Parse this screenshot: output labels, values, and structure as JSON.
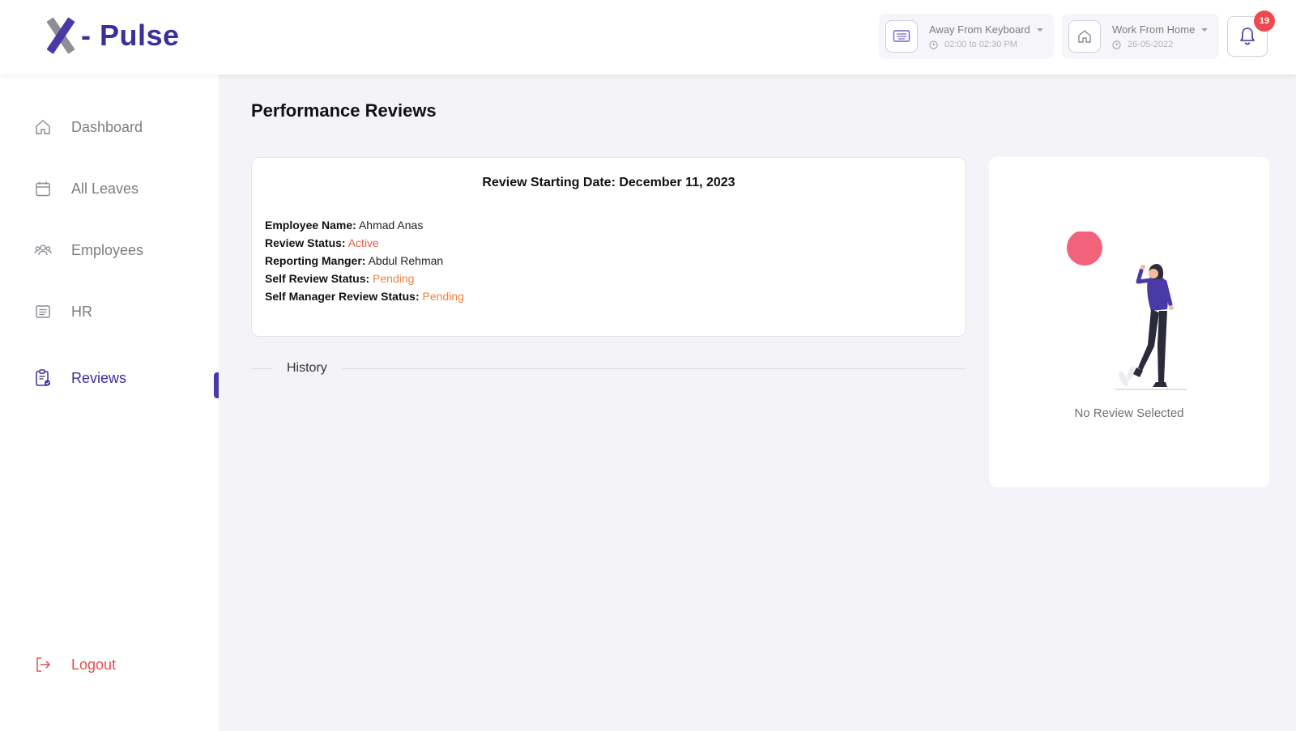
{
  "app": {
    "logo_text": "- Pulse"
  },
  "header": {
    "away_status": {
      "title": "Away From Keyboard",
      "sub": "02:00 to 02:30 PM"
    },
    "work_status": {
      "title": "Work From Home",
      "sub": "26-05-2022"
    },
    "notifications_count": "19"
  },
  "sidebar": {
    "items": [
      {
        "label": "Dashboard",
        "icon": "home-icon"
      },
      {
        "label": "All Leaves",
        "icon": "calendar-icon"
      },
      {
        "label": "Employees",
        "icon": "users-icon"
      },
      {
        "label": "HR",
        "icon": "list-icon"
      },
      {
        "label": "Reviews",
        "icon": "clipboard-icon",
        "active": true
      }
    ],
    "logout_label": "Logout"
  },
  "main": {
    "title": "Performance Reviews",
    "review": {
      "starting_date": "Review Starting Date: December 11, 2023",
      "fields": [
        {
          "key": "Employee Name:",
          "value": "Ahmad Anas"
        },
        {
          "key": "Review Status:",
          "value": "Active"
        },
        {
          "key": "Reporting Manger:",
          "value": "Abdul Rehman"
        },
        {
          "key": "Self Review Status:",
          "value": "Pending"
        },
        {
          "key": "Self Manager Review Status:",
          "value": "Pending"
        }
      ]
    },
    "history_label": "History",
    "empty_state": "No Review Selected"
  },
  "colors": {
    "brand": "#3b2f9c",
    "active_status": "#e8594e",
    "pending_status": "#f0803c",
    "logout": "#e05050",
    "badge": "#f0484f",
    "accent_circle": "#f2627a"
  }
}
